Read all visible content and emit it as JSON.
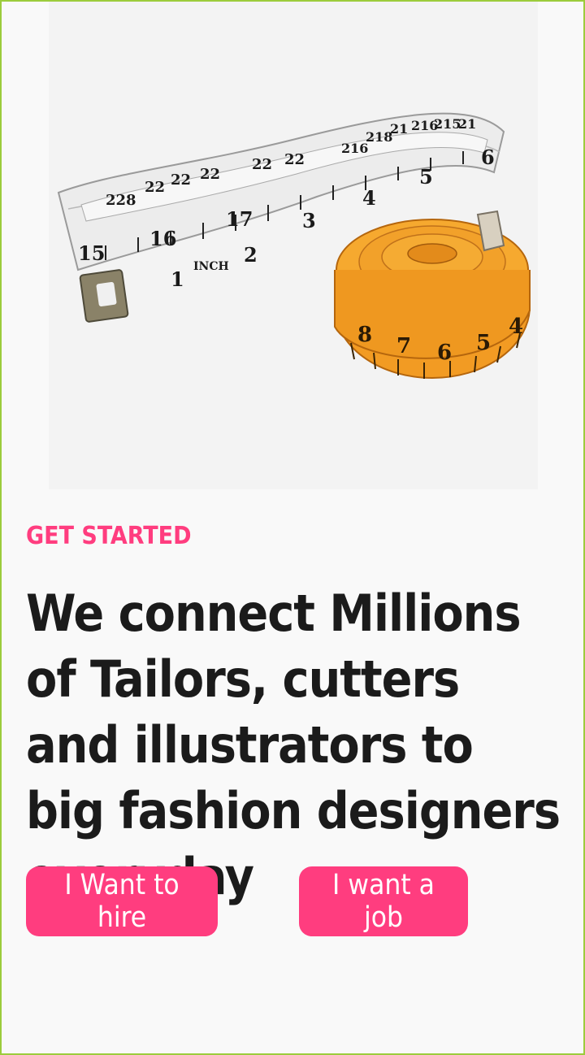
{
  "onboarding": {
    "eyebrow": "GET STARTED",
    "headline": "We connect Millions of Tailors, cutters and illustrators to big fashion designers everyday",
    "actions": {
      "hire_label": "I Want to hire",
      "job_label": "I want a job"
    }
  },
  "hero_image": {
    "icon": "tape-measure-illustration",
    "white_tape_labels": [
      "228",
      "22",
      "22",
      "22",
      "22",
      "216",
      "218",
      "21",
      "215",
      "21",
      "15",
      "16",
      "17",
      "1",
      "2",
      "3",
      "4",
      "5",
      "6",
      "INCH"
    ],
    "orange_tape_labels": [
      "8",
      "7",
      "6",
      "5",
      "4"
    ]
  },
  "colors": {
    "accent": "#ff3d7f",
    "frame_border": "#9ccc3c",
    "background": "#f9f9f9",
    "text": "#1b1b1b"
  }
}
